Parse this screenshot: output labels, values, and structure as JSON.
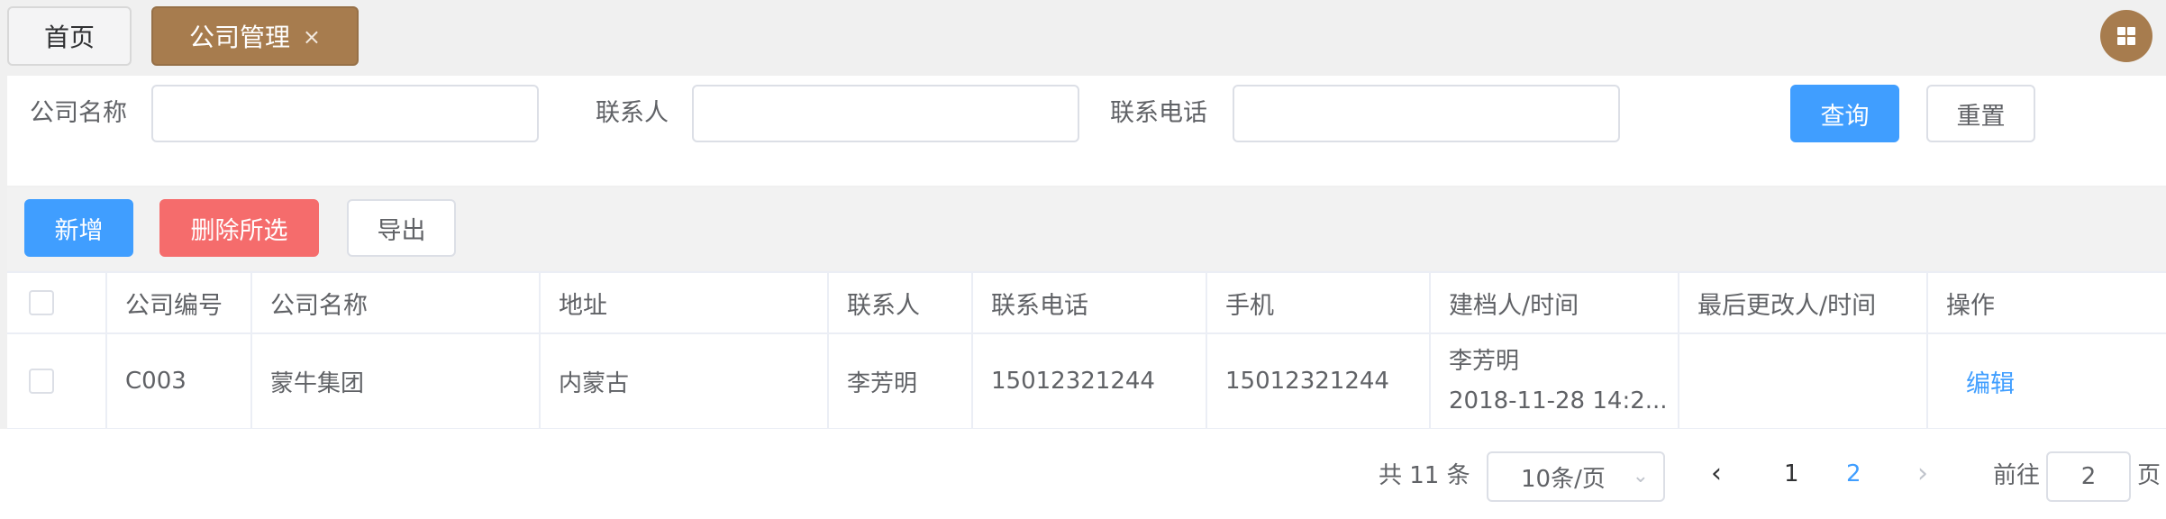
{
  "tabs": [
    {
      "label": "首页"
    },
    {
      "label": "公司管理",
      "close": "×"
    }
  ],
  "search": {
    "company_name_label": "公司名称",
    "company_name_value": "",
    "contact_label": "联系人",
    "contact_value": "",
    "phone_label": "联系电话",
    "phone_value": "",
    "query_label": "查询",
    "reset_label": "重置"
  },
  "toolbar": {
    "add_label": "新增",
    "delete_label": "删除所选",
    "export_label": "导出"
  },
  "table": {
    "columns": [
      "公司编号",
      "公司名称",
      "地址",
      "联系人",
      "联系电话",
      "手机",
      "建档人/时间",
      "最后更改人/时间",
      "操作"
    ],
    "rows": [
      {
        "code": "C003",
        "name": "蒙牛集团",
        "address": "内蒙古",
        "contact": "李芳明",
        "phone": "15012321244",
        "mobile": "15012321244",
        "creator": "李芳明",
        "created_at": "2018-11-28 14:2...",
        "modifier": "",
        "action": "编辑"
      }
    ]
  },
  "pagination": {
    "total_text": "共 11 条",
    "page_size": "10条/页",
    "prev": "‹",
    "pages": [
      "1",
      "2"
    ],
    "current_page": "2",
    "next": "›",
    "goto_label": "前往",
    "goto_value": "2",
    "page_suffix": "页"
  },
  "colors": {
    "accent": "#a77c4e",
    "primary": "#409eff",
    "danger": "#f56c6c"
  },
  "icons": {
    "tab_close": "close-icon",
    "menu": "grid-icon",
    "select_chevron": "chevron-down-icon"
  }
}
